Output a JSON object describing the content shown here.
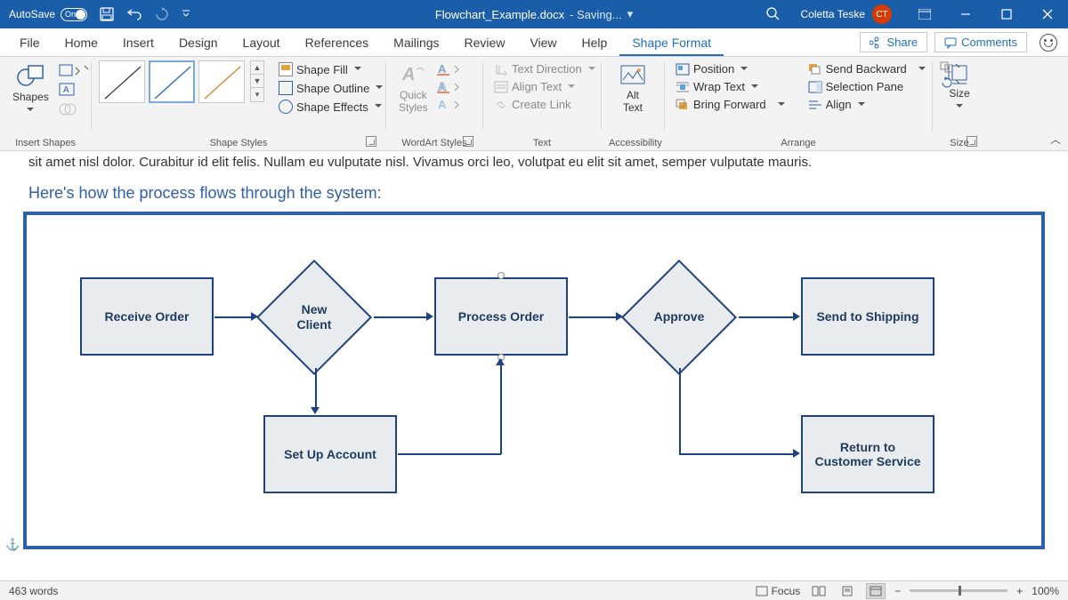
{
  "titlebar": {
    "autosave": "AutoSave",
    "autosave_state": "On",
    "doc_title": "Flowchart_Example.docx",
    "saving": "Saving...",
    "user": "Coletta Teske",
    "initials": "CT"
  },
  "tabs": [
    "File",
    "Home",
    "Insert",
    "Design",
    "Layout",
    "References",
    "Mailings",
    "Review",
    "View",
    "Help",
    "Shape Format"
  ],
  "active_tab": "Shape Format",
  "share": "Share",
  "comments": "Comments",
  "ribbon": {
    "groups": {
      "insert_shapes": {
        "label": "Insert Shapes",
        "shapes_btn": "Shapes",
        "edit_shape": "",
        "draw_text": ""
      },
      "shape_styles": {
        "label": "Shape Styles",
        "fill": "Shape Fill",
        "outline": "Shape Outline",
        "effects": "Shape Effects"
      },
      "wordart": {
        "label": "WordArt Styles",
        "quick_styles": "Quick\nStyles"
      },
      "text": {
        "label": "Text",
        "direction": "Text Direction",
        "align": "Align Text",
        "link": "Create Link"
      },
      "accessibility": {
        "label": "Accessibility",
        "alt": "Alt\nText"
      },
      "arrange": {
        "label": "Arrange",
        "position": "Position",
        "wrap": "Wrap Text",
        "forward": "Bring Forward",
        "backward": "Send Backward",
        "selection": "Selection Pane",
        "align": "Align"
      },
      "size": {
        "label": "Size",
        "btn": "Size"
      }
    }
  },
  "doc": {
    "partial": "sit amet nisl dolor. Curabitur id elit felis. Nullam eu vulputate nisl. Vivamus orci leo, volutpat eu elit sit amet, semper vulputate mauris.",
    "intro": "Here's how the process flows through the system:",
    "shapes": {
      "receive": "Receive Order",
      "new_client": "New\nClient",
      "process": "Process Order",
      "approve": "Approve",
      "shipping": "Send to Shipping",
      "setup": "Set Up Account",
      "return": "Return to\nCustomer Service"
    }
  },
  "status": {
    "words": "463 words",
    "focus": "Focus",
    "zoom": "100%"
  }
}
